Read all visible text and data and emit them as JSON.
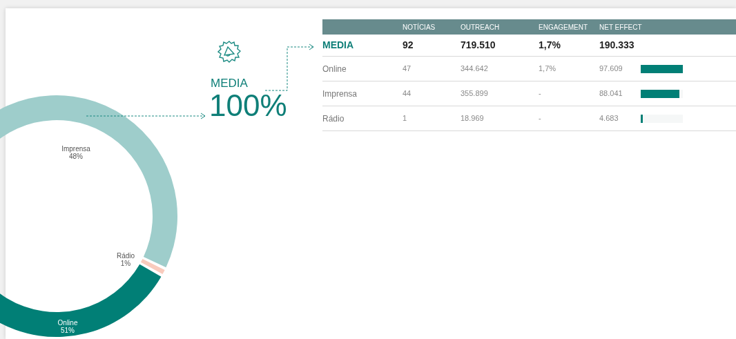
{
  "donut": {
    "chart_data": {
      "type": "donut",
      "categories": [
        "Imprensa",
        "Rádio",
        "Online"
      ],
      "series": [
        {
          "values": [
            48,
            1,
            51
          ]
        }
      ],
      "colors": [
        "#9ecdcb",
        "#f9cbbd",
        "#017f76"
      ],
      "value_labels": [
        "48%",
        "1%",
        "51%"
      ]
    }
  },
  "summary": {
    "title": "MEDIA",
    "value": "100%"
  },
  "table": {
    "columns": [
      "",
      "NOTÍCIAS",
      "OUTREACH",
      "ENGAGEMENT",
      "NET EFFECT"
    ],
    "total": {
      "cells": [
        "MEDIA",
        "92",
        "719.510",
        "1,7%",
        "190.333"
      ]
    },
    "rows": [
      {
        "cells": [
          "Online",
          "47",
          "344.642",
          "1,7%",
          "97.609"
        ],
        "level": 1
      },
      {
        "cells": [
          "Imprensa",
          "44",
          "355.899",
          "-",
          "88.041"
        ],
        "level": 0.92
      },
      {
        "cells": [
          "Rádio",
          "1",
          "18.969",
          "-",
          "4.683"
        ],
        "level": 0.05
      }
    ]
  }
}
